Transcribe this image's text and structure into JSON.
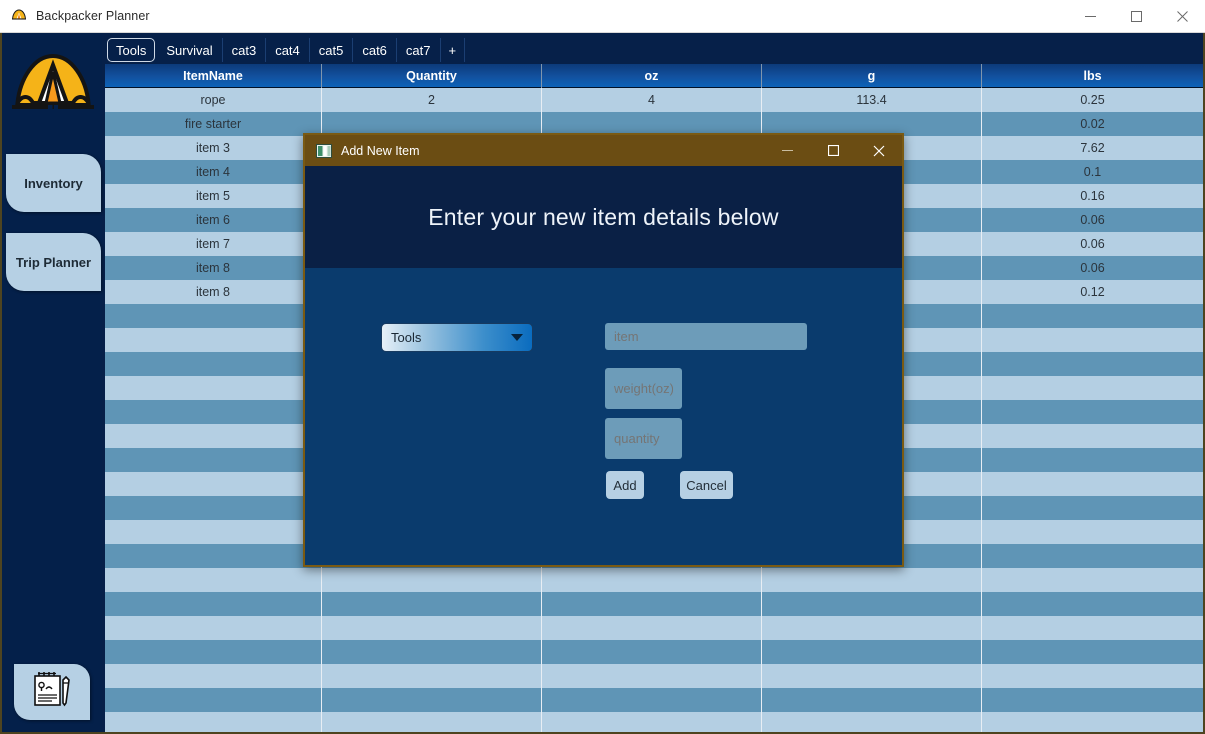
{
  "window": {
    "title": "Backpacker Planner",
    "app_icon": "tent-icon",
    "controls": [
      {
        "name": "minimize-button",
        "icon": "minimize-icon"
      },
      {
        "name": "maximize-button",
        "icon": "maximize-icon"
      },
      {
        "name": "close-button",
        "icon": "close-icon"
      }
    ]
  },
  "sidebar": {
    "logo": "tent-logo",
    "buttons": [
      {
        "label": "Inventory"
      },
      {
        "label": "Trip Planner"
      }
    ],
    "note_icon": "notepad-pen-icon"
  },
  "tabs": {
    "selected": "Tools",
    "items": [
      {
        "label": "Tools"
      },
      {
        "label": "Survival"
      },
      {
        "label": "cat3"
      },
      {
        "label": "cat4"
      },
      {
        "label": "cat5"
      },
      {
        "label": "cat6"
      },
      {
        "label": "cat7"
      },
      {
        "label": "+"
      }
    ]
  },
  "table": {
    "columns": [
      "ItemName",
      "Quantity",
      "oz",
      "g",
      "lbs"
    ],
    "rows": [
      [
        "rope",
        "2",
        "4",
        "113.4",
        "0.25"
      ],
      [
        "fire starter",
        "",
        "",
        "",
        "0.02"
      ],
      [
        "item 3",
        "",
        "",
        "",
        "7.62"
      ],
      [
        "item 4",
        "",
        "",
        "",
        "0.1"
      ],
      [
        "item 5",
        "",
        "",
        "",
        "0.16"
      ],
      [
        "item 6",
        "",
        "",
        "",
        "0.06"
      ],
      [
        "item 7",
        "",
        "",
        "",
        "0.06"
      ],
      [
        "item 8",
        "",
        "",
        "",
        "0.06"
      ],
      [
        "item 8",
        "",
        "",
        "",
        "0.12"
      ],
      [
        "",
        "",
        "",
        "",
        ""
      ],
      [
        "",
        "",
        "",
        "",
        ""
      ],
      [
        "",
        "",
        "",
        "",
        ""
      ],
      [
        "",
        "",
        "",
        "",
        ""
      ],
      [
        "",
        "",
        "",
        "",
        ""
      ],
      [
        "",
        "",
        "",
        "",
        ""
      ],
      [
        "",
        "",
        "",
        "",
        ""
      ],
      [
        "",
        "",
        "",
        "",
        ""
      ],
      [
        "",
        "",
        "",
        "",
        ""
      ],
      [
        "",
        "",
        "",
        "",
        ""
      ],
      [
        "",
        "",
        "",
        "",
        ""
      ],
      [
        "",
        "",
        "",
        "",
        ""
      ],
      [
        "",
        "",
        "",
        "",
        ""
      ],
      [
        "",
        "",
        "",
        "",
        ""
      ],
      [
        "",
        "",
        "",
        "",
        ""
      ],
      [
        "",
        "",
        "",
        "",
        ""
      ],
      [
        "",
        "",
        "",
        "",
        ""
      ],
      [
        "",
        "",
        "",
        "",
        ""
      ]
    ]
  },
  "dialog": {
    "title": "Add New Item",
    "icon": "window-panes-icon",
    "heading": "Enter  your new item details below",
    "category_select": {
      "value": "Tools"
    },
    "fields": [
      {
        "name": "item-name-input",
        "placeholder": "item",
        "value": ""
      },
      {
        "name": "weight-input",
        "placeholder": "weight(oz)",
        "value": ""
      },
      {
        "name": "quantity-input",
        "placeholder": "quantity",
        "value": ""
      }
    ],
    "buttons": [
      {
        "label": "Add"
      },
      {
        "label": "Cancel"
      }
    ],
    "controls": [
      {
        "name": "minimize-button",
        "icon": "minimize-icon"
      },
      {
        "name": "maximize-button",
        "icon": "maximize-icon"
      },
      {
        "name": "close-button",
        "icon": "close-icon"
      }
    ]
  },
  "colors": {
    "navy": "#04204a",
    "panel_blue": "#0a3b6d",
    "row_light": "#b4cfe3",
    "row_dark": "#5f95b6",
    "dialog_titlebar": "#6b4d13",
    "accent_yellow": "#f5b318"
  }
}
